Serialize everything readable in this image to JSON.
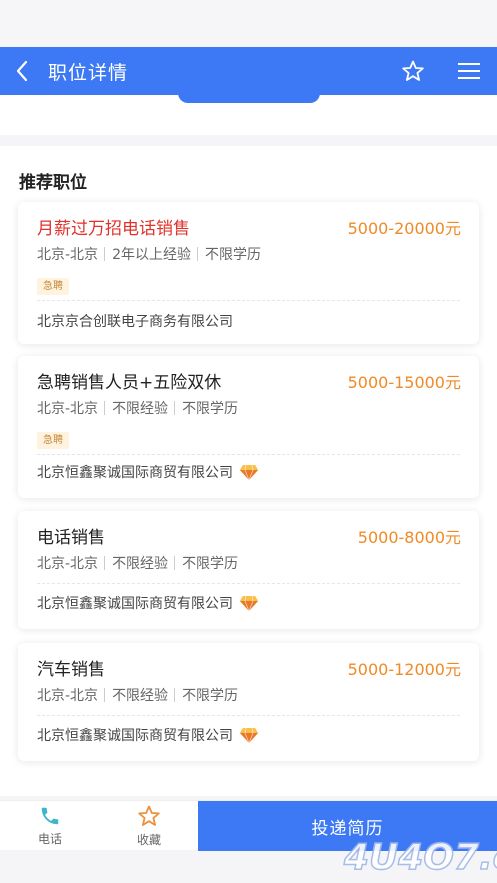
{
  "header": {
    "title": "职位详情"
  },
  "section": {
    "title": "推荐职位"
  },
  "jobs": [
    {
      "title": "月薪过万招电话销售",
      "salary": "5000-20000元",
      "location": "北京-北京",
      "experience": "2年以上经验",
      "education": "不限学历",
      "tag": "急聘",
      "company": "北京京合创联电子商务有限公司",
      "verified": false,
      "highlight": true
    },
    {
      "title": "急聘销售人员+五险双休",
      "salary": "5000-15000元",
      "location": "北京-北京",
      "experience": "不限经验",
      "education": "不限学历",
      "tag": "急聘",
      "company": "北京恒鑫聚诚国际商贸有限公司",
      "verified": true,
      "highlight": false
    },
    {
      "title": "电话销售",
      "salary": "5000-8000元",
      "location": "北京-北京",
      "experience": "不限经验",
      "education": "不限学历",
      "tag": "",
      "company": "北京恒鑫聚诚国际商贸有限公司",
      "verified": true,
      "highlight": false
    },
    {
      "title": "汽车销售",
      "salary": "5000-12000元",
      "location": "北京-北京",
      "experience": "不限经验",
      "education": "不限学历",
      "tag": "",
      "company": "北京恒鑫聚诚国际商贸有限公司",
      "verified": true,
      "highlight": false
    }
  ],
  "bottom_bar": {
    "phone_label": "电话",
    "favorite_label": "收藏",
    "submit_label": "投递简历"
  },
  "watermark": {
    "text": "4U4O7.com"
  },
  "colors": {
    "primary": "#3d79f4",
    "salary": "#f08a26",
    "hot_title": "#e0312b",
    "tag_bg": "#fff3df",
    "tag_text": "#c38a3a",
    "phone_icon": "#3fb5c9",
    "favorite_icon": "#ee8f3a"
  },
  "icons": {
    "back": "chevron-left-icon",
    "favorite_header": "star-outline-icon",
    "menu": "hamburger-menu-icon",
    "phone": "phone-icon",
    "favorite": "star-outline-icon",
    "verified": "diamond-icon"
  }
}
